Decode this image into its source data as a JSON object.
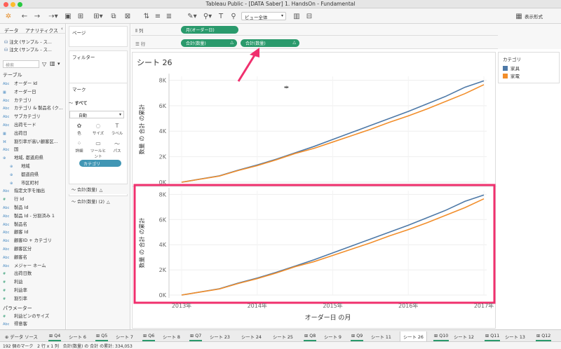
{
  "window": {
    "title": "Tableau Public - [DATA Saber] 1. HandsOn - Fundamental"
  },
  "toolbar": {
    "view_select": "ビュー全体",
    "show_me": "表示形式"
  },
  "left_pane": {
    "tab_data": "データ",
    "tab_analytics": "アナリティクス",
    "datasources": [
      "注文 (サンプル - ス...",
      "注文 (サンプル - ス..."
    ],
    "search_placeholder": "検索",
    "tables_header": "テーブル",
    "fields": [
      {
        "type": "Abc",
        "label": "オーダー Id"
      },
      {
        "type": "date",
        "label": "オーダー日"
      },
      {
        "type": "Abc",
        "label": "カテゴリ"
      },
      {
        "type": "Abc",
        "label": "カテゴリ & 製品名 (ク..."
      },
      {
        "type": "Abc",
        "label": "サブカテゴリ"
      },
      {
        "type": "Abc",
        "label": "出荷モード"
      },
      {
        "type": "date",
        "label": "出荷日"
      },
      {
        "type": "clip",
        "label": "割引率が高い顧客区..."
      },
      {
        "type": "Abc",
        "label": "国"
      },
      {
        "type": "geo",
        "label": "地域, 都道府県"
      },
      {
        "type": "globe",
        "label": "地域",
        "indent": true
      },
      {
        "type": "globe",
        "label": "都道府県",
        "indent": true
      },
      {
        "type": "globe",
        "label": "市区町村",
        "indent": true
      },
      {
        "type": "Abc",
        "label": "指定文字を抽出"
      },
      {
        "type": "#",
        "label": "行 Id"
      },
      {
        "type": "Abc",
        "label": "製品 Id"
      },
      {
        "type": "Abc",
        "label": "製品 Id - 分割済み 1"
      },
      {
        "type": "Abc",
        "label": "製品名"
      },
      {
        "type": "Abc",
        "label": "顧客 Id"
      },
      {
        "type": "Abc",
        "label": "顧客ID + カテゴリ"
      },
      {
        "type": "Abc",
        "label": "顧客区分"
      },
      {
        "type": "Abc",
        "label": "顧客名"
      },
      {
        "type": "Abc",
        "label": "メジャー ネーム"
      },
      {
        "type": "#",
        "label": "出荷日数"
      },
      {
        "type": "#",
        "label": "利益"
      },
      {
        "type": "#",
        "label": "利益率"
      },
      {
        "type": "#",
        "label": "割引率"
      }
    ],
    "params_header": "パラメーター",
    "params": [
      {
        "type": "#",
        "label": "利益ビンのサイズ"
      },
      {
        "type": "Abc",
        "label": "得意客"
      }
    ]
  },
  "mid_pane": {
    "pages": "ページ",
    "filters": "フィルター",
    "marks": "マーク",
    "marks_all": "すべて",
    "marks_type": "自動",
    "mark_buttons": [
      "色",
      "サイズ",
      "ラベル",
      "詳細",
      "ツールヒント",
      "パス"
    ],
    "category_pill": "カテゴリ",
    "measure_rows": [
      "合計(数量)",
      "合計(数量) (2)"
    ]
  },
  "shelves": {
    "columns_label": "列",
    "rows_label": "行",
    "columns_pill": "月(オーダー日)",
    "rows_pills": [
      "合計(数量)",
      "合計(数量)"
    ]
  },
  "sheet": {
    "title": "シート 26"
  },
  "legend": {
    "title": "カテゴリ",
    "items": [
      {
        "label": "家具",
        "color": "#4e79a7"
      },
      {
        "label": "家電",
        "color": "#f28e2b"
      }
    ]
  },
  "annotation_colors": {
    "highlight": "#f0306e"
  },
  "chart_data": {
    "type": "line",
    "panes": 2,
    "xlabel": "オーダー日 の月",
    "ylabel": "数量 の 合計 の累計",
    "x_ticks": [
      "2013年",
      "2014年",
      "2015年",
      "2016年",
      "2017年"
    ],
    "y_ticks": [
      "0K",
      "2K",
      "4K",
      "6K",
      "8K"
    ],
    "ylim": [
      0,
      8300
    ],
    "x": [
      "2013-01",
      "2013-04",
      "2013-07",
      "2013-10",
      "2014-01",
      "2014-04",
      "2014-07",
      "2014-10",
      "2015-01",
      "2015-04",
      "2015-07",
      "2015-10",
      "2016-01",
      "2016-04",
      "2016-07",
      "2016-10",
      "2016-12"
    ],
    "series": [
      {
        "name": "家具",
        "color": "#4e79a7",
        "values": [
          0,
          250,
          500,
          950,
          1350,
          1800,
          2300,
          2800,
          3350,
          3900,
          4450,
          5000,
          5550,
          6150,
          6750,
          7450,
          7950
        ]
      },
      {
        "name": "家電",
        "color": "#f28e2b",
        "values": [
          0,
          240,
          480,
          920,
          1300,
          1750,
          2250,
          2650,
          3150,
          3650,
          4150,
          4700,
          5200,
          5750,
          6350,
          6950,
          7650
        ]
      }
    ]
  },
  "tabs": [
    "Q4",
    "シート 6",
    "Q5",
    "シート 7",
    "Q6",
    "シート 8",
    "Q7",
    "シート 23",
    "シート 24",
    "シート 25",
    "Q8",
    "シート 9",
    "Q9",
    "シート 11",
    "シート 26",
    "Q10",
    "シート 12",
    "Q11",
    "シート 13",
    "Q12"
  ],
  "tabs_active": "シート 26",
  "status": {
    "marks": "192 個のマーク",
    "rows": "2 行 x 1 列",
    "sum": "合計(数量) の 合計 の累計: 334,053"
  }
}
